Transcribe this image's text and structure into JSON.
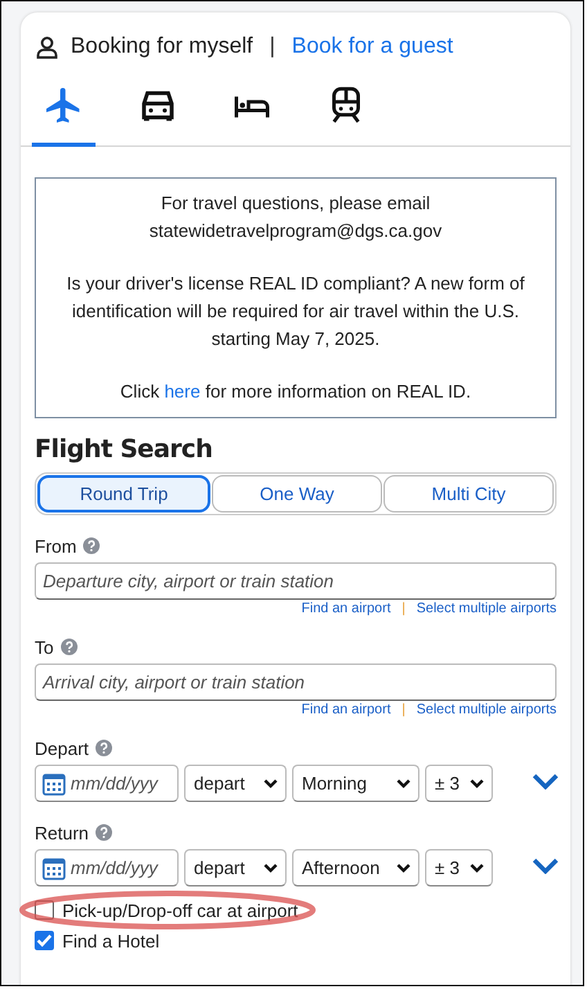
{
  "booking": {
    "self_label": "Booking for myself",
    "separator": "|",
    "guest_link": "Book for a guest"
  },
  "travel_tabs": [
    {
      "kind": "flight",
      "selected": true
    },
    {
      "kind": "car",
      "selected": false
    },
    {
      "kind": "hotel",
      "selected": false
    },
    {
      "kind": "train",
      "selected": false
    }
  ],
  "notice": {
    "paragraphs": [
      {
        "text": "For travel questions, please email statewidetravelprogram@dgs.ca.gov"
      },
      {
        "text": "Is your driver's license REAL ID compliant? A new form of identification will be required for air travel within the U.S. starting May 7, 2025."
      },
      {
        "before": "Click ",
        "link": "here",
        "after": " for more information on REAL ID."
      }
    ]
  },
  "flight_search": {
    "title": "Flight Search",
    "trip_types": [
      {
        "label": "Round Trip",
        "selected": true
      },
      {
        "label": "One Way",
        "selected": false
      },
      {
        "label": "Multi City",
        "selected": false
      }
    ],
    "locations": [
      {
        "label": "From",
        "placeholder": "Departure city, airport or train station",
        "links": [
          "Find an airport",
          "Select multiple airports"
        ],
        "separator": "|"
      },
      {
        "label": "To",
        "placeholder": "Arrival city, airport or train station",
        "links": [
          "Find an airport",
          "Select multiple airports"
        ],
        "separator": "|"
      }
    ],
    "dates": [
      {
        "label": "Depart",
        "date_placeholder": "mm/dd/yyy",
        "mode": "depart",
        "time": "Morning",
        "range": "± 3"
      },
      {
        "label": "Return",
        "date_placeholder": "mm/dd/yyy",
        "mode": "depart",
        "time": "Afternoon",
        "range": "± 3"
      }
    ],
    "options": [
      {
        "label": "Pick-up/Drop-off car at airport",
        "checked": false,
        "circled": true
      },
      {
        "label": "Find a Hotel",
        "checked": true,
        "circled": false
      }
    ]
  }
}
